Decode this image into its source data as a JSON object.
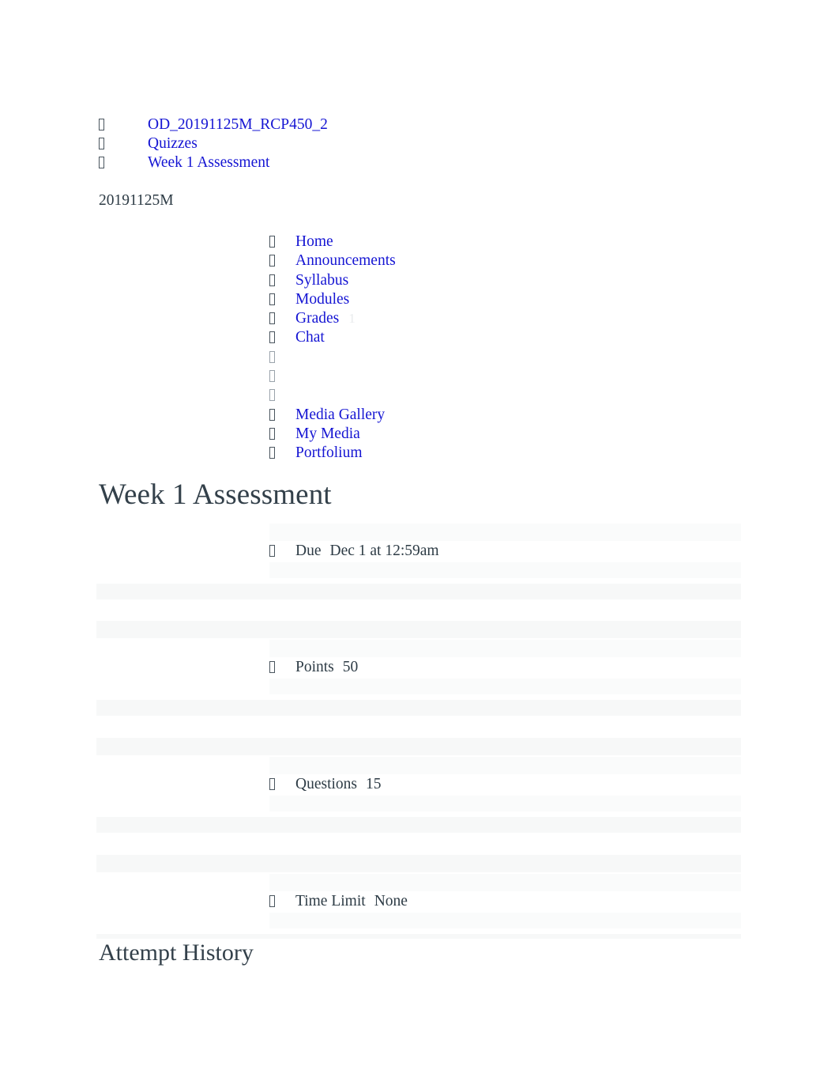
{
  "breadcrumb": {
    "items": [
      {
        "label": "OD_20191125M_RCP450_2",
        "icon": "tofu-bullet-icon"
      },
      {
        "label": "Quizzes",
        "icon": "tofu-bullet-icon"
      },
      {
        "label": "Week 1 Assessment",
        "icon": "tofu-bullet-icon"
      }
    ]
  },
  "course": {
    "code": "20191125M"
  },
  "nav": {
    "items": [
      {
        "label": "Home",
        "badge": "",
        "empty": false
      },
      {
        "label": "Announcements",
        "badge": "",
        "empty": false
      },
      {
        "label": "Syllabus",
        "badge": "",
        "empty": false
      },
      {
        "label": "Modules",
        "badge": "",
        "empty": false
      },
      {
        "label": "Grades",
        "badge": "1",
        "empty": false
      },
      {
        "label": "Chat",
        "badge": "",
        "empty": false
      },
      {
        "label": "",
        "badge": "",
        "empty": true
      },
      {
        "label": "",
        "badge": "",
        "empty": true
      },
      {
        "label": "",
        "badge": "",
        "empty": true
      },
      {
        "label": "Media Gallery",
        "badge": "",
        "empty": false
      },
      {
        "label": "My Media",
        "badge": "",
        "empty": false
      },
      {
        "label": "Portfolium",
        "badge": "",
        "empty": false
      }
    ]
  },
  "quiz": {
    "title": "Week 1 Assessment",
    "details": [
      {
        "label": "Due",
        "value": "Dec 1 at 12:59am"
      },
      {
        "label": "Points",
        "value": "50"
      },
      {
        "label": "Questions",
        "value": "15"
      },
      {
        "label": "Time Limit",
        "value": "None"
      }
    ]
  },
  "attempt_history": {
    "title": "Attempt History"
  },
  "colors": {
    "link": "#1515d3",
    "ink": "#2D3B45",
    "heading": "#33404a",
    "band": "#f7f8f8",
    "badge": "#e9ebed"
  }
}
